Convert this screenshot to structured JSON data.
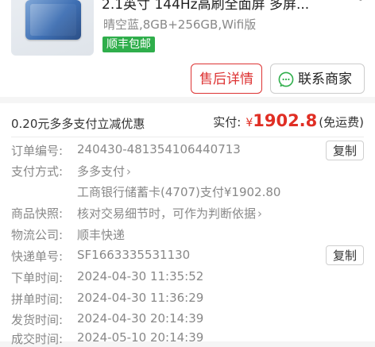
{
  "product": {
    "title": "2.1英寸 144Hz高刷全面屏 多屏...",
    "sku": "晴空蓝,8GB+256GB,Wifi版",
    "shipping_tag": "顺丰包邮"
  },
  "actions": {
    "aftersale_label": "售后详情",
    "contact_label": "联系商家"
  },
  "payment_summary": {
    "promo_text": "0.20元多多支付立减优惠",
    "paid_label": "实付:",
    "currency": "¥",
    "amount": "1902.8",
    "shipping_note": "(免运费)"
  },
  "order_info": {
    "order_no_label": "订单编号:",
    "order_no": "240430-481354106440713",
    "copy_label": "复制",
    "pay_method_label": "支付方式:",
    "pay_method": "多多支付",
    "pay_detail": "工商银行储蓄卡(4707)支付¥1902.80",
    "snapshot_label": "商品快照:",
    "snapshot_text": "核对交易细节时，可作为判断依据",
    "logistics_label": "物流公司:",
    "logistics_company": "顺丰快递",
    "tracking_label": "快递单号:",
    "tracking_no": "SF1663335531130",
    "order_time_label": "下单时间:",
    "order_time": "2024-04-30 11:35:52",
    "group_time_label": "拼单时间:",
    "group_time": "2024-04-30 11:36:29",
    "ship_time_label": "发货时间:",
    "ship_time": "2024-04-30 20:14:39",
    "deal_time_label": "成交时间:",
    "deal_time": "2024-05-10 20:14:39"
  },
  "icons": {
    "chevron": "chevron-right-icon",
    "chat": "chat-bubble-icon",
    "more": "more-icon"
  },
  "colors": {
    "accent_red": "#e02e24",
    "tag_green": "#2fae4b"
  }
}
